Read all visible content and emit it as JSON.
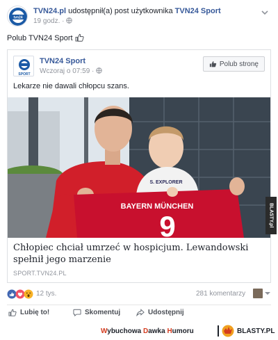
{
  "header": {
    "page_name": "TVN24.pl",
    "shared_text": "udostępnił(a)",
    "post_word": "post",
    "user_text": "użytkownika",
    "source_page": "TVN24 Sport",
    "time": "19 godz. ·"
  },
  "like_prompt": {
    "prefix": "Polub",
    "page": "TVN24 Sport"
  },
  "shared": {
    "page_name": "TVN24 Sport",
    "time": "Wczoraj o 07:59 ·",
    "like_page_label": "Polub stronę",
    "text": "Lekarze nie dawali chłopcu szans.",
    "photo_alt_text_shirt": "BAYERN MÜNCHEN",
    "link_title": "Chłopiec chciał umrzeć w hospicjum. Lewandowski spełnił jego marzenie",
    "link_source": "SPORT.TVN24.PL",
    "avatar_text": "tvn24",
    "sub_avatar_text": "SPORT"
  },
  "side_watermark": "BLASTY.pl",
  "stats": {
    "reactions": "12 tys.",
    "comments": "281 komentarzy"
  },
  "actions": {
    "like": "Lubię to!",
    "comment": "Skomentuj",
    "share": "Udostępnij"
  },
  "footer": {
    "w1": "W",
    "w1_rest": "ybuchowa ",
    "w2": "D",
    "w2_rest": "awka ",
    "w3": "H",
    "w3_rest": "umoru",
    "brand": "BLASTY.PL"
  },
  "colors": {
    "link_blue": "#365899",
    "muted": "#90949c",
    "accent_red": "#d43b1e"
  }
}
